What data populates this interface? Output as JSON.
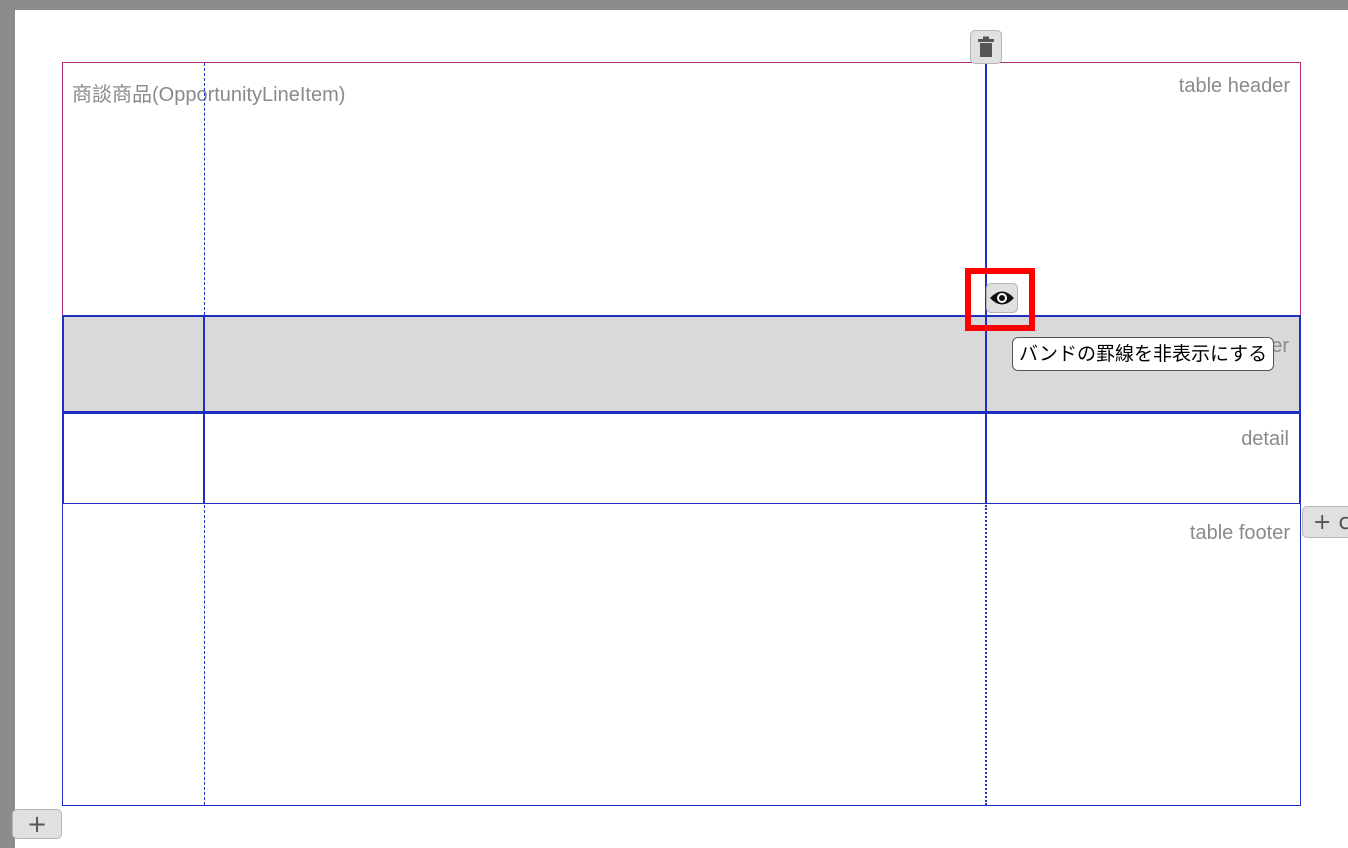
{
  "object_name": "商談商品(OpportunityLineItem)",
  "bands": {
    "table_header": "table header",
    "column_header_partial": "er",
    "detail": "detail",
    "table_footer": "table footer"
  },
  "buttons": {
    "add_row": "+",
    "add_column": "+ c"
  },
  "tooltip": "バンドの罫線を非表示にする",
  "icons": {
    "delete": "trash-icon",
    "toggle_borders": "eye-icon"
  },
  "colors": {
    "band_border": "#1f2fbf",
    "header_border": "#b0307a",
    "highlight": "#ff0000",
    "selected_band_bg": "#d9d9d9"
  }
}
